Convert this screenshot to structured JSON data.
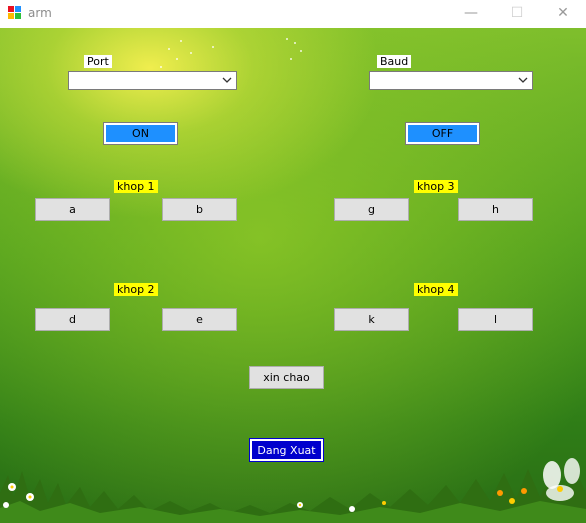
{
  "window": {
    "title": "arm",
    "minimize_glyph": "—",
    "maximize_glyph": "☐",
    "close_glyph": "✕"
  },
  "serial": {
    "port_label": "Port",
    "port_value": "",
    "baud_label": "Baud",
    "baud_value": ""
  },
  "power": {
    "on_label": "ON",
    "off_label": "OFF"
  },
  "joints": {
    "khop1": {
      "label": "khop 1",
      "btn_a": "a",
      "btn_b": "b"
    },
    "khop2": {
      "label": "khop 2",
      "btn_a": "d",
      "btn_b": "e"
    },
    "khop3": {
      "label": "khop 3",
      "btn_a": "g",
      "btn_b": "h"
    },
    "khop4": {
      "label": "khop 4",
      "btn_a": "k",
      "btn_b": "l"
    }
  },
  "actions": {
    "hello_label": "xin chao",
    "logout_label": "Dang Xuat"
  },
  "colors": {
    "blue_button": "#1e90ff",
    "label_yellow": "#ffff00",
    "logout_button": "#0000cd"
  }
}
